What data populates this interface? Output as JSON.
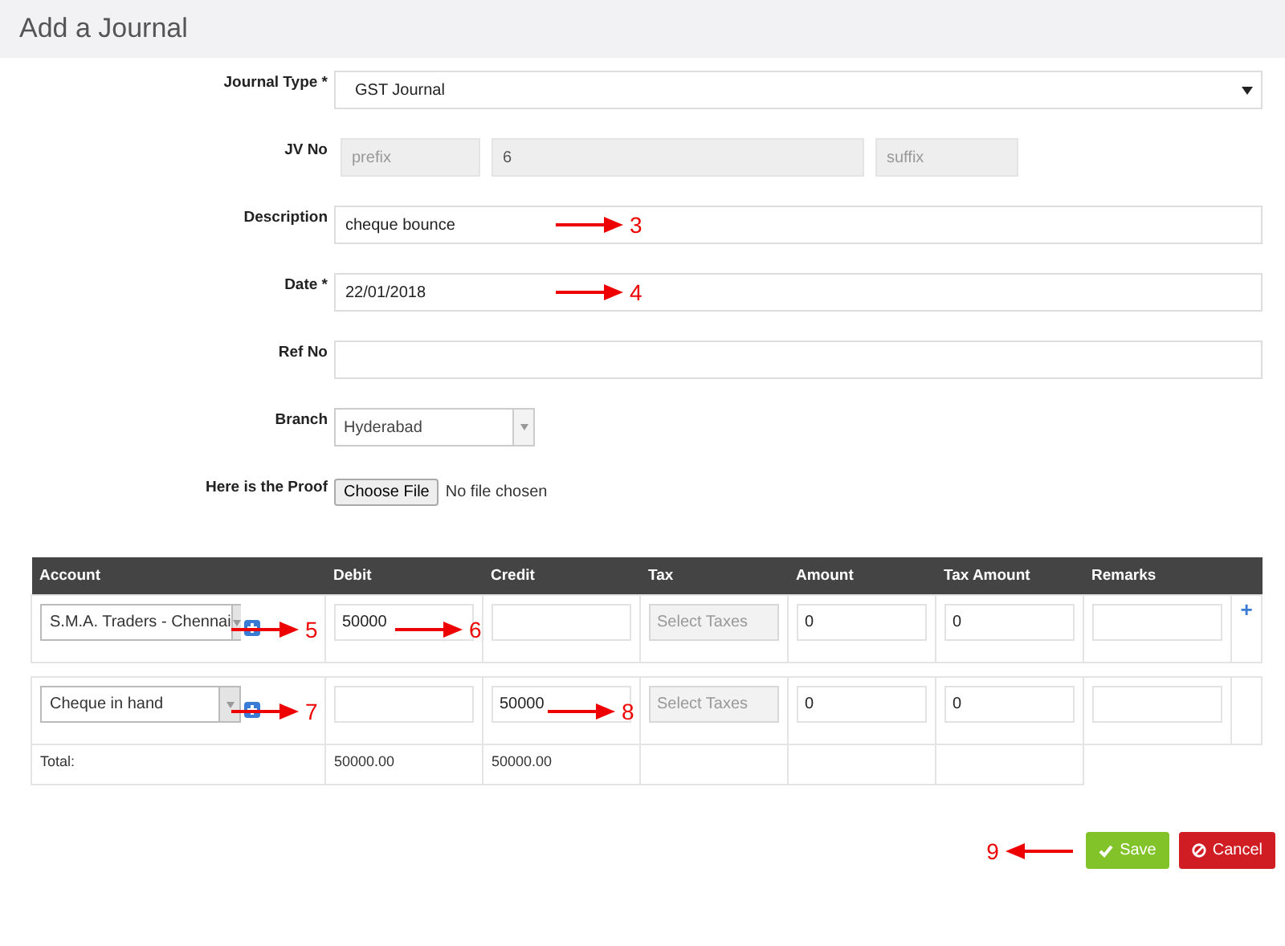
{
  "page_title": "Add a Journal",
  "form": [
    {
      "kind": "select",
      "label": "Journal Type *",
      "value": "GST Journal"
    },
    {
      "kind": "jv",
      "label": "JV No",
      "prefix_placeholder": "prefix",
      "number": "6",
      "suffix_placeholder": "suffix"
    },
    {
      "kind": "text",
      "label": "Description",
      "value": "cheque bounce",
      "annotation": "3"
    },
    {
      "kind": "text",
      "label": "Date *",
      "value": "22/01/2018",
      "annotation": "4"
    },
    {
      "kind": "text",
      "label": "Ref No"
    },
    {
      "kind": "combo",
      "label": "Branch",
      "value": "Hyderabad"
    },
    {
      "kind": "file",
      "label": "Here is the Proof",
      "button": "Choose File",
      "status": "No file chosen"
    }
  ],
  "table": {
    "columns": [
      "Account",
      "Debit",
      "Credit",
      "Tax",
      "Amount",
      "Tax Amount",
      "Remarks"
    ],
    "rows": [
      {
        "account": "S.M.A. Traders - Chennai",
        "account_annotation": "5",
        "debit": "50000",
        "debit_annotation": "6",
        "tax_placeholder": "Select Taxes",
        "amount": "0",
        "tax_amount": "0",
        "add": "+"
      },
      {
        "account": "Cheque in hand",
        "account_annotation": "7",
        "credit": "50000",
        "credit_annotation": "8",
        "tax_placeholder": "Select Taxes",
        "amount": "0",
        "tax_amount": "0"
      }
    ],
    "totals": {
      "label": "Total:",
      "debit": "50000.00",
      "credit": "50000.00"
    }
  },
  "buttons_annotation": "9",
  "buttons": [
    {
      "kind": "save",
      "label": "Save"
    },
    {
      "kind": "cancel",
      "label": "Cancel"
    }
  ]
}
